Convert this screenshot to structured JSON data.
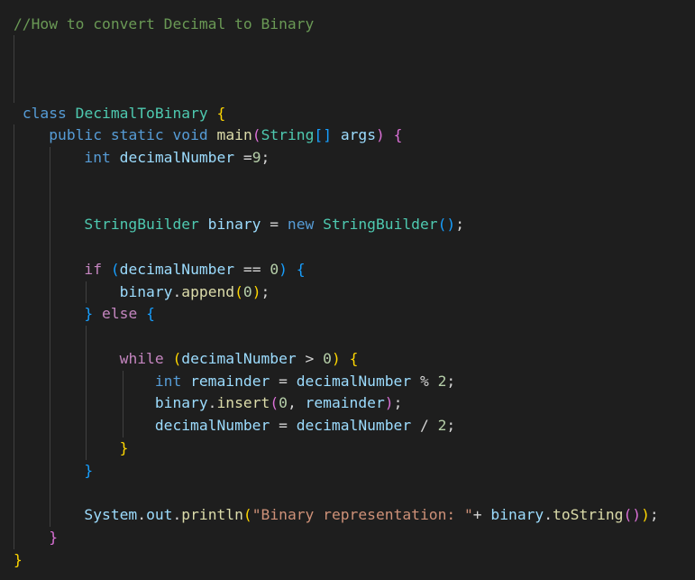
{
  "editor": {
    "language": "java",
    "colors": {
      "background": "#1e1e1e",
      "comment": "#6a9955",
      "keyword_blue": "#569cd6",
      "control": "#c586c0",
      "type": "#4ec9b0",
      "function": "#dcdcaa",
      "variable": "#9cdcfe",
      "number": "#b5cea8",
      "string": "#ce9178",
      "text": "#d4d4d4",
      "bracket_gold": "#ffd700",
      "bracket_pink": "#da70d6",
      "bracket_blue": "#179fff",
      "indent_guide": "#404040"
    },
    "lines": [
      {
        "indent": "",
        "tokens": [
          {
            "t": "//How to convert Decimal to Binary",
            "c": "comment"
          }
        ]
      },
      {
        "indent": "",
        "tokens": []
      },
      {
        "indent": "",
        "tokens": []
      },
      {
        "indent": "",
        "tokens": []
      },
      {
        "indent": " ",
        "tokens": [
          {
            "t": "class",
            "c": "keyword_blue"
          },
          {
            "t": " ",
            "c": "text"
          },
          {
            "t": "DecimalToBinary",
            "c": "type"
          },
          {
            "t": " ",
            "c": "text"
          },
          {
            "t": "{",
            "c": "bracket_gold"
          }
        ]
      },
      {
        "indent": "    ",
        "tokens": [
          {
            "t": "public",
            "c": "keyword_blue"
          },
          {
            "t": " ",
            "c": "text"
          },
          {
            "t": "static",
            "c": "keyword_blue"
          },
          {
            "t": " ",
            "c": "text"
          },
          {
            "t": "void",
            "c": "keyword_blue"
          },
          {
            "t": " ",
            "c": "text"
          },
          {
            "t": "main",
            "c": "function"
          },
          {
            "t": "(",
            "c": "bracket_pink"
          },
          {
            "t": "String",
            "c": "type"
          },
          {
            "t": "[]",
            "c": "bracket_blue"
          },
          {
            "t": " ",
            "c": "text"
          },
          {
            "t": "args",
            "c": "variable"
          },
          {
            "t": ")",
            "c": "bracket_pink"
          },
          {
            "t": " ",
            "c": "text"
          },
          {
            "t": "{",
            "c": "bracket_pink"
          }
        ]
      },
      {
        "indent": "        ",
        "tokens": [
          {
            "t": "int",
            "c": "keyword_blue"
          },
          {
            "t": " ",
            "c": "text"
          },
          {
            "t": "decimalNumber",
            "c": "variable"
          },
          {
            "t": " =",
            "c": "text"
          },
          {
            "t": "9",
            "c": "number"
          },
          {
            "t": ";",
            "c": "text"
          }
        ]
      },
      {
        "indent": "",
        "tokens": []
      },
      {
        "indent": "",
        "tokens": []
      },
      {
        "indent": "        ",
        "tokens": [
          {
            "t": "StringBuilder",
            "c": "type"
          },
          {
            "t": " ",
            "c": "text"
          },
          {
            "t": "binary",
            "c": "variable"
          },
          {
            "t": " = ",
            "c": "text"
          },
          {
            "t": "new",
            "c": "keyword_blue"
          },
          {
            "t": " ",
            "c": "text"
          },
          {
            "t": "StringBuilder",
            "c": "type"
          },
          {
            "t": "()",
            "c": "bracket_blue"
          },
          {
            "t": ";",
            "c": "text"
          }
        ]
      },
      {
        "indent": "",
        "tokens": []
      },
      {
        "indent": "        ",
        "tokens": [
          {
            "t": "if",
            "c": "control"
          },
          {
            "t": " ",
            "c": "text"
          },
          {
            "t": "(",
            "c": "bracket_blue"
          },
          {
            "t": "decimalNumber",
            "c": "variable"
          },
          {
            "t": " == ",
            "c": "text"
          },
          {
            "t": "0",
            "c": "number"
          },
          {
            "t": ")",
            "c": "bracket_blue"
          },
          {
            "t": " ",
            "c": "text"
          },
          {
            "t": "{",
            "c": "bracket_blue"
          }
        ]
      },
      {
        "indent": "            ",
        "tokens": [
          {
            "t": "binary",
            "c": "variable"
          },
          {
            "t": ".",
            "c": "text"
          },
          {
            "t": "append",
            "c": "function"
          },
          {
            "t": "(",
            "c": "bracket_gold"
          },
          {
            "t": "0",
            "c": "number"
          },
          {
            "t": ")",
            "c": "bracket_gold"
          },
          {
            "t": ";",
            "c": "text"
          }
        ]
      },
      {
        "indent": "        ",
        "tokens": [
          {
            "t": "}",
            "c": "bracket_blue"
          },
          {
            "t": " ",
            "c": "text"
          },
          {
            "t": "else",
            "c": "control"
          },
          {
            "t": " ",
            "c": "text"
          },
          {
            "t": "{",
            "c": "bracket_blue"
          }
        ]
      },
      {
        "indent": "",
        "tokens": []
      },
      {
        "indent": "            ",
        "tokens": [
          {
            "t": "while",
            "c": "control"
          },
          {
            "t": " ",
            "c": "text"
          },
          {
            "t": "(",
            "c": "bracket_gold"
          },
          {
            "t": "decimalNumber",
            "c": "variable"
          },
          {
            "t": " > ",
            "c": "text"
          },
          {
            "t": "0",
            "c": "number"
          },
          {
            "t": ")",
            "c": "bracket_gold"
          },
          {
            "t": " ",
            "c": "text"
          },
          {
            "t": "{",
            "c": "bracket_gold"
          }
        ]
      },
      {
        "indent": "                ",
        "tokens": [
          {
            "t": "int",
            "c": "keyword_blue"
          },
          {
            "t": " ",
            "c": "text"
          },
          {
            "t": "remainder",
            "c": "variable"
          },
          {
            "t": " = ",
            "c": "text"
          },
          {
            "t": "decimalNumber",
            "c": "variable"
          },
          {
            "t": " % ",
            "c": "text"
          },
          {
            "t": "2",
            "c": "number"
          },
          {
            "t": ";",
            "c": "text"
          }
        ]
      },
      {
        "indent": "                ",
        "tokens": [
          {
            "t": "binary",
            "c": "variable"
          },
          {
            "t": ".",
            "c": "text"
          },
          {
            "t": "insert",
            "c": "function"
          },
          {
            "t": "(",
            "c": "bracket_pink"
          },
          {
            "t": "0",
            "c": "number"
          },
          {
            "t": ", ",
            "c": "text"
          },
          {
            "t": "remainder",
            "c": "variable"
          },
          {
            "t": ")",
            "c": "bracket_pink"
          },
          {
            "t": ";",
            "c": "text"
          }
        ]
      },
      {
        "indent": "                ",
        "tokens": [
          {
            "t": "decimalNumber",
            "c": "variable"
          },
          {
            "t": " = ",
            "c": "text"
          },
          {
            "t": "decimalNumber",
            "c": "variable"
          },
          {
            "t": " / ",
            "c": "text"
          },
          {
            "t": "2",
            "c": "number"
          },
          {
            "t": ";",
            "c": "text"
          }
        ]
      },
      {
        "indent": "            ",
        "tokens": [
          {
            "t": "}",
            "c": "bracket_gold"
          }
        ]
      },
      {
        "indent": "        ",
        "tokens": [
          {
            "t": "}",
            "c": "bracket_blue"
          }
        ]
      },
      {
        "indent": "",
        "tokens": []
      },
      {
        "indent": "        ",
        "tokens": [
          {
            "t": "System",
            "c": "variable"
          },
          {
            "t": ".",
            "c": "text"
          },
          {
            "t": "out",
            "c": "variable"
          },
          {
            "t": ".",
            "c": "text"
          },
          {
            "t": "println",
            "c": "function"
          },
          {
            "t": "(",
            "c": "bracket_gold"
          },
          {
            "t": "\"Binary representation: \"",
            "c": "string"
          },
          {
            "t": "+ ",
            "c": "text"
          },
          {
            "t": "binary",
            "c": "variable"
          },
          {
            "t": ".",
            "c": "text"
          },
          {
            "t": "toString",
            "c": "function"
          },
          {
            "t": "()",
            "c": "bracket_pink"
          },
          {
            "t": ")",
            "c": "bracket_gold"
          },
          {
            "t": ";",
            "c": "text"
          }
        ]
      },
      {
        "indent": "    ",
        "tokens": [
          {
            "t": "}",
            "c": "bracket_pink"
          }
        ]
      },
      {
        "indent": "",
        "tokens": [
          {
            "t": "}",
            "c": "bracket_gold"
          }
        ]
      }
    ]
  }
}
